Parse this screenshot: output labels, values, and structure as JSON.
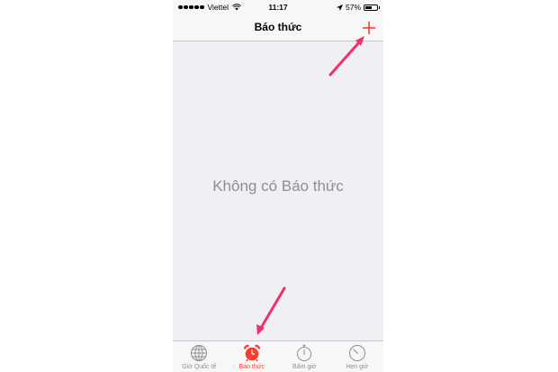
{
  "status_bar": {
    "carrier": "Viettel",
    "time": "11:17",
    "battery_percent": "57%",
    "battery_level": 0.57,
    "icons": [
      "signal-dots",
      "wifi-icon",
      "location-arrow-icon",
      "battery-icon"
    ]
  },
  "nav_bar": {
    "title": "Báo thức",
    "add_icon": "plus-icon"
  },
  "content": {
    "empty_message": "Không có Báo thức"
  },
  "tab_bar": {
    "tabs": [
      {
        "label": "Giờ Quốc tế",
        "icon": "globe-icon",
        "active": false
      },
      {
        "label": "Báo thức",
        "icon": "alarm-clock-icon",
        "active": true
      },
      {
        "label": "Bấm giờ",
        "icon": "stopwatch-icon",
        "active": false
      },
      {
        "label": "Hẹn giờ",
        "icon": "timer-icon",
        "active": false
      }
    ]
  },
  "colors": {
    "accent": "#ff3b30",
    "annotation_arrow": "#f0306a",
    "background": "#efeff4",
    "inactive": "#8e8e93"
  }
}
